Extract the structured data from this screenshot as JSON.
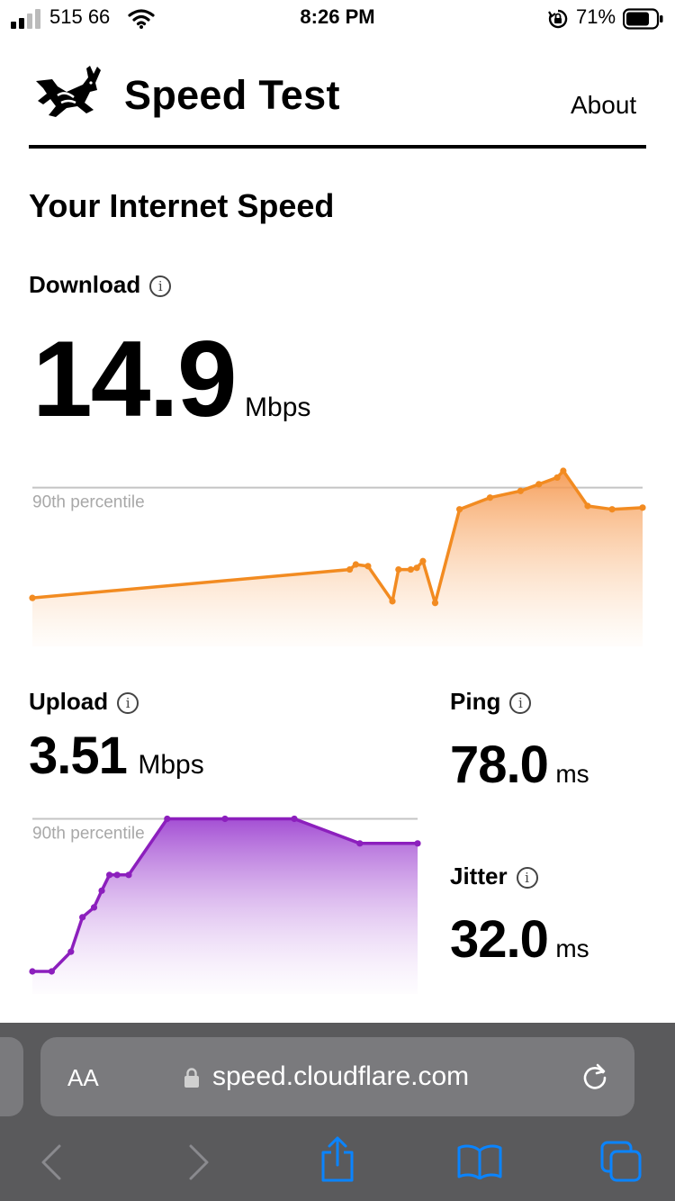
{
  "status_bar": {
    "carrier": "515 66",
    "time": "8:26 PM",
    "battery_percent": "71%"
  },
  "header": {
    "title": "Speed Test",
    "about_label": "About"
  },
  "section_title": "Your Internet Speed",
  "download": {
    "label": "Download",
    "value": "14.9",
    "unit": "Mbps",
    "percentile_label": "90th percentile"
  },
  "upload": {
    "label": "Upload",
    "value": "3.51",
    "unit": "Mbps",
    "percentile_label": "90th percentile"
  },
  "ping": {
    "label": "Ping",
    "value": "78.0",
    "unit": "ms"
  },
  "jitter": {
    "label": "Jitter",
    "value": "32.0",
    "unit": "ms"
  },
  "browser": {
    "text_size_label": "AA",
    "url": "speed.cloudflare.com"
  },
  "colors": {
    "download": "#f28b21",
    "upload": "#8c1fbd"
  },
  "chart_data": [
    {
      "type": "area",
      "title": "",
      "series": [
        {
          "values": [
            2.2,
            3.9,
            4.2,
            4.1,
            2.0,
            3.9,
            3.9,
            4.0,
            4.4,
            1.9,
            7.5,
            8.2,
            8.6,
            9.0,
            9.4,
            9.8,
            7.7,
            7.5,
            7.6
          ]
        }
      ],
      "x": [
        0,
        52,
        53,
        55,
        59,
        60,
        62,
        63,
        64,
        66,
        70,
        75,
        80,
        83,
        86,
        87,
        91,
        95,
        100
      ],
      "reference_line": {
        "label": "90th percentile",
        "value": 8.8
      },
      "ylim": [
        0,
        10.5
      ]
    },
    {
      "type": "area",
      "title": "",
      "series": [
        {
          "values": [
            0.0,
            0.0,
            0.2,
            0.55,
            0.65,
            0.82,
            0.98,
            0.98,
            0.98,
            1.55,
            1.55,
            1.55,
            1.3,
            1.3
          ]
        }
      ],
      "x": [
        0,
        5,
        10,
        13,
        16,
        18,
        20,
        22,
        25,
        35,
        50,
        68,
        85,
        100
      ],
      "reference_line": {
        "label": "90th percentile",
        "value": 1.55
      },
      "ylim": [
        0,
        1.6
      ]
    }
  ]
}
